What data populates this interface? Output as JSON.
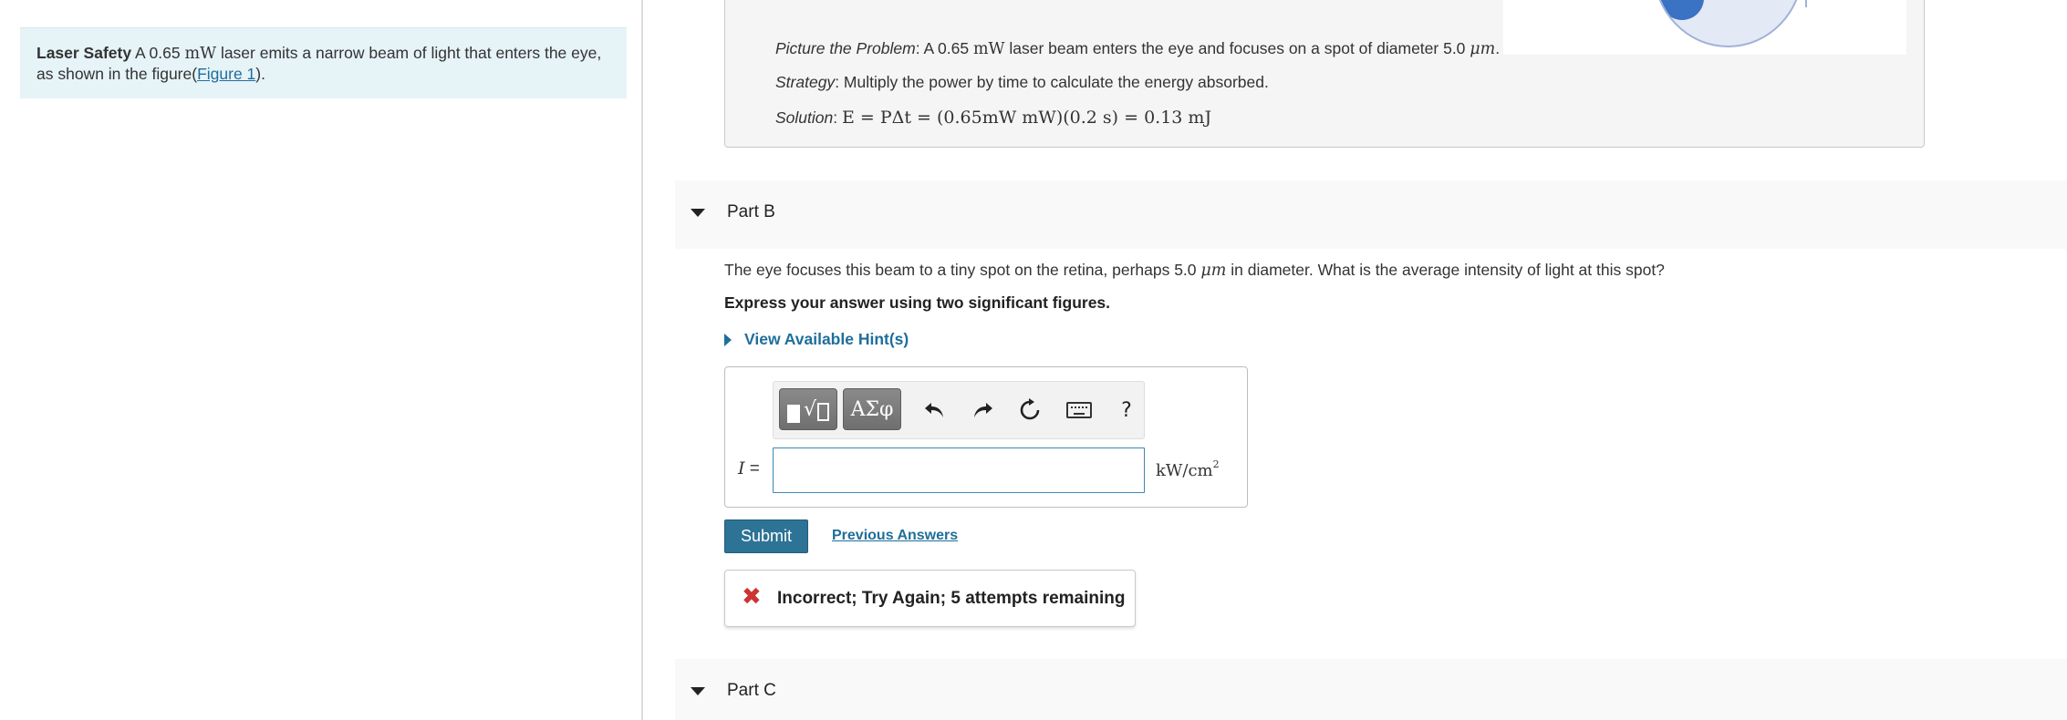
{
  "intro": {
    "title": "Laser Safety",
    "text_before": " A 0.65 ",
    "power_unit": "mW",
    "text_after": " laser emits a narrow beam of light that enters the eye, as shown in the figure(",
    "figure_link": "Figure 1",
    "text_end": ")."
  },
  "solution": {
    "problem_label": "Picture the Problem",
    "problem_text": ": A 0.65 ",
    "problem_unit": "mW",
    "problem_text2": " laser beam enters the eye and focuses on a spot of diameter 5.0 ",
    "problem_unit2": "μm",
    "problem_end": ".",
    "strategy_label": "Strategy",
    "strategy_text": ": Multiply the power by time to calculate the energy absorbed.",
    "solution_label": "Solution",
    "solution_sep": ": ",
    "solution_math": "E = PΔt = (0.65mW mW)(0.2 s) = 0.13 mJ"
  },
  "part_b": {
    "title": "Part B",
    "question_before": "The eye focuses this beam to a tiny spot on the retina, perhaps 5.0 ",
    "question_unit": "μm",
    "question_after": " in diameter. What is the average intensity of light at this spot?",
    "instruction": "Express your answer using two significant figures.",
    "hints_label": "View Available Hint(s)",
    "toolbar": {
      "greek_label": "ΑΣφ",
      "help_label": "?"
    },
    "variable": "I",
    "equals": " =",
    "answer_value": "",
    "units_base": "kW/cm",
    "units_exp": "2",
    "submit_label": "Submit",
    "previous_answers_label": "Previous Answers",
    "feedback_icon": "✖",
    "feedback_text": "Incorrect; Try Again; 5 attempts remaining"
  },
  "part_c": {
    "title": "Part C"
  },
  "icons": {
    "undo": "undo-icon",
    "redo": "redo-icon",
    "reset": "reset-icon",
    "keyboard": "keyboard-icon",
    "help": "help-icon"
  }
}
